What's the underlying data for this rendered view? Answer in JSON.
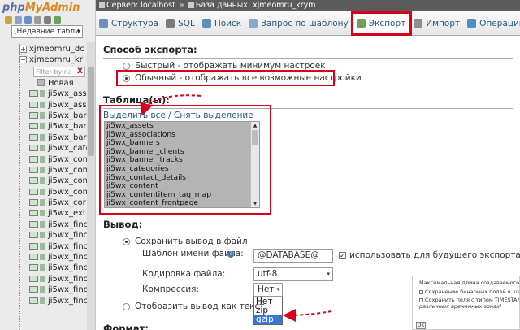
{
  "nav": {
    "logo_part1": "php",
    "logo_part2": "MyAdmin",
    "db_select": "(Недавние табли",
    "db_select_arrow": "▾",
    "db_rows": [
      {
        "toggle": "+",
        "label": "xjmeomru_dc"
      },
      {
        "toggle": "−",
        "label": "xjmeomru_kr"
      }
    ],
    "filter_placeholder": "Filter by na",
    "filter_clear": "X",
    "new_label": "Новая",
    "tables": [
      "ji5wx_ass",
      "ji5wx_ass",
      "ji5wx_bar",
      "ji5wx_bar",
      "ji5wx_bar",
      "ji5wx_cate",
      "ji5wx_con",
      "ji5wx_con",
      "ji5wx_con",
      "ji5wx_con",
      "ji5wx_cor",
      "ji5wx_ext",
      "ji5wx_finc",
      "ji5wx_finc",
      "ji5wx_finc",
      "ji5wx_finc",
      "ji5wx_finc",
      "ji5wx_finc",
      "ji5wx_finc",
      "ji5wx_finc"
    ]
  },
  "breadcrumb": {
    "server": "Сервер: localhost",
    "separator": "»",
    "database": "База данных: xjmeomru_krym"
  },
  "tabs": [
    {
      "name": "tab-structure",
      "label": "Структура",
      "color": "#6b8fc2"
    },
    {
      "name": "tab-sql",
      "label": "SQL",
      "color": "#7a7a7a"
    },
    {
      "name": "tab-search",
      "label": "Поиск",
      "color": "#5b8fbf"
    },
    {
      "name": "tab-query",
      "label": "Запрос по шаблону",
      "color": "#8aa6cf"
    },
    {
      "name": "tab-export",
      "label": "Экспорт",
      "color": "#6f9f5f"
    },
    {
      "name": "tab-import",
      "label": "Импорт",
      "color": "#8f8f8f"
    },
    {
      "name": "tab-operations",
      "label": "Операции",
      "color": "#4f8fbf"
    }
  ],
  "export_method": {
    "title": "Способ экспорта:",
    "quick": "Быстрый - отображать минимум настроек",
    "custom": "Обычный - отображать все возможные настройки"
  },
  "tables_section": {
    "title": "Таблица(ы):",
    "select_all": "Выделить все",
    "link_sep": "/",
    "deselect_all": "Снять выделение",
    "items": [
      "ji5wx_assets",
      "ji5wx_associations",
      "ji5wx_banners",
      "ji5wx_banner_clients",
      "ji5wx_banner_tracks",
      "ji5wx_categories",
      "ji5wx_contact_details",
      "ji5wx_content",
      "ji5wx_contentitem_tag_map",
      "ji5wx_content_frontpage"
    ],
    "scroll_up": "▲",
    "scroll_down": "▼"
  },
  "output": {
    "title": "Вывод:",
    "save_to_file": "Сохранить вывод в файл",
    "filename_template_label": "Шаблон имени файла:",
    "filename_template_value": "@DATABASE@",
    "remember_template": "использовать для будущего экспорта",
    "remember_checked": "✓",
    "charset_label": "Кодировка файла:",
    "charset_value": "utf-8",
    "compression_label": "Компрессия:",
    "compression_value": "Нет",
    "compression_options": [
      "Нет",
      "zip",
      "gzip"
    ],
    "compression_highlighted": "gzip",
    "show_as_text": "Отобразить вывод как текст"
  },
  "format": {
    "title": "Формат:"
  },
  "overlay": {
    "line1": "Максимальная длина создаваемого",
    "line2": "Сохранение бинарных полей в шес",
    "line3": "Сохранить поля с типом TIMESTAMP",
    "line4": "различных временных зонах)",
    "ok": "OK"
  },
  "colors": {
    "highlight": "#d9001b",
    "link": "#235a81",
    "selected_option": "#3875d7"
  }
}
